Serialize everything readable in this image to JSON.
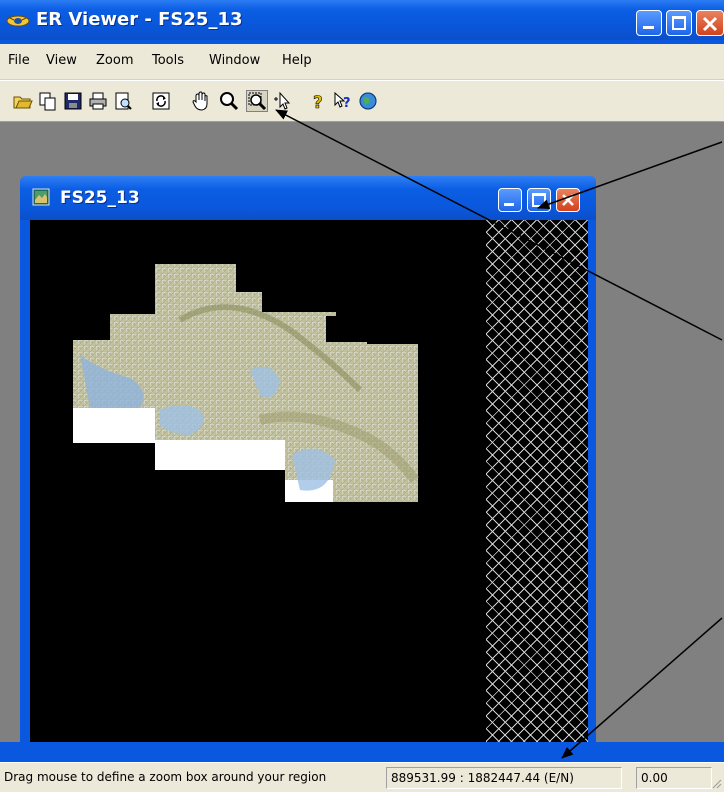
{
  "app": {
    "title": "ER Viewer - FS25_13"
  },
  "menu": {
    "items": [
      "File",
      "View",
      "Zoom",
      "Tools",
      "Window",
      "Help"
    ]
  },
  "toolbar": {
    "buttons": [
      "open-icon",
      "copy-icon",
      "save-icon",
      "print-icon",
      "print-preview-icon",
      "refresh-icon",
      "pan-hand-icon",
      "zoom-icon",
      "zoom-box-icon",
      "pointer-icon",
      "help-icon",
      "context-help-icon",
      "about-globe-icon"
    ],
    "pressed": "zoom-box-icon"
  },
  "child_window": {
    "title": "FS25_13"
  },
  "statusbar": {
    "message": "Drag mouse to define a zoom box around your region",
    "coordinates": "889531.99 : 1882447.44 (E/N)",
    "value": "0.00"
  },
  "colors": {
    "title_blue": "#0a55d9",
    "chrome": "#ece9d8",
    "mdi_background": "#808080",
    "close_red": "#d3421c"
  }
}
